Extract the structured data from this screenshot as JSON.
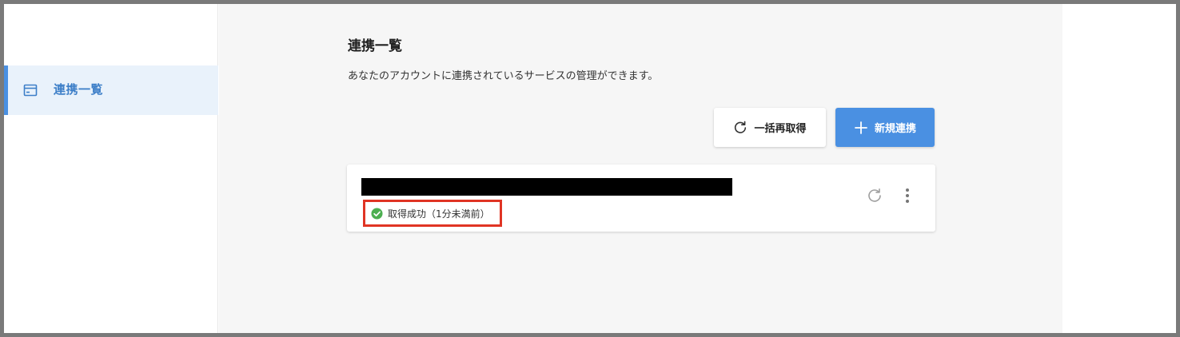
{
  "sidebar": {
    "items": [
      {
        "label": "連携一覧",
        "icon": "card-icon",
        "active": true
      }
    ]
  },
  "main": {
    "title": "連携一覧",
    "description": "あなたのアカウントに連携されているサービスの管理ができます。",
    "buttons": {
      "refresh_all": {
        "label": "一括再取得",
        "icon": "refresh-icon"
      },
      "new_link": {
        "label": "新規連携",
        "icon": "plus-icon"
      }
    },
    "cards": [
      {
        "name_redacted": true,
        "status": "取得成功（1分未満前）",
        "status_icon": "check-circle-icon"
      }
    ]
  },
  "colors": {
    "accent": "#4a90e2",
    "success": "#4caf50",
    "highlight_border": "#e03424",
    "sidebar_active_bg": "#e9f2fb"
  }
}
